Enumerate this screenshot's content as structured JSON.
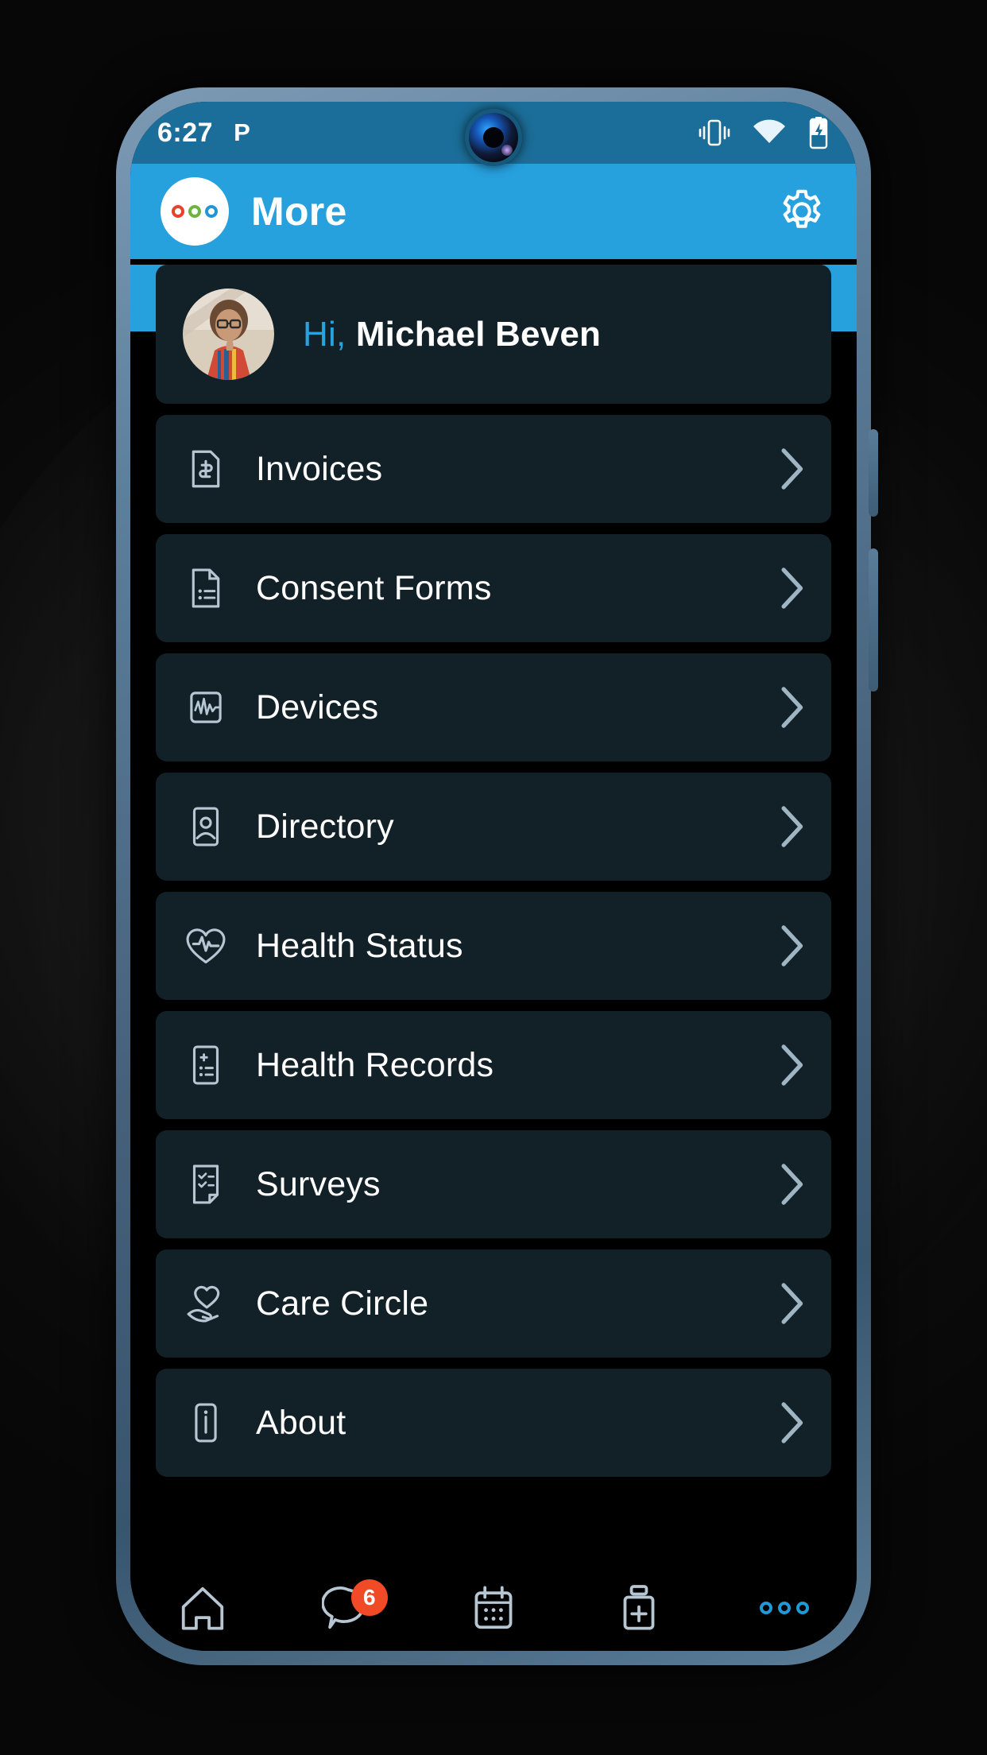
{
  "status_bar": {
    "time": "6:27",
    "carrier_glyph": "P",
    "icons": [
      "vibrate-icon",
      "wifi-icon",
      "battery-charging-icon"
    ]
  },
  "app_bar": {
    "title": "More",
    "logo_name": "app-logo",
    "logo_ring_colors": [
      "#e8412c",
      "#6cb33f",
      "#2196d6"
    ],
    "settings_icon": "gear-icon",
    "background_color": "#27a0de"
  },
  "profile": {
    "greeting_prefix": "Hi,",
    "user_name": "Michael Beven",
    "avatar_name": "user-avatar",
    "greeting_accent_color": "#29a3e0"
  },
  "menu": {
    "card_color": "#122028",
    "items": [
      {
        "label": "Invoices",
        "icon": "invoice-dollar-icon"
      },
      {
        "label": "Consent Forms",
        "icon": "document-lines-icon"
      },
      {
        "label": "Devices",
        "icon": "device-waveform-icon"
      },
      {
        "label": "Directory",
        "icon": "person-card-icon"
      },
      {
        "label": "Health Status",
        "icon": "heart-pulse-icon"
      },
      {
        "label": "Health Records",
        "icon": "medical-record-icon"
      },
      {
        "label": "Surveys",
        "icon": "checklist-icon"
      },
      {
        "label": "Care Circle",
        "icon": "heart-in-hand-icon"
      },
      {
        "label": "About",
        "icon": "info-icon"
      }
    ],
    "chevron_icon": "chevron-right-icon"
  },
  "tab_bar": {
    "tabs": [
      {
        "name": "home",
        "icon": "home-icon",
        "badge": "",
        "active": false
      },
      {
        "name": "messages",
        "icon": "chat-bubble-icon",
        "badge": "6",
        "active": false
      },
      {
        "name": "calendar",
        "icon": "calendar-icon",
        "badge": "",
        "active": false
      },
      {
        "name": "medication",
        "icon": "pill-bottle-icon",
        "badge": "",
        "active": false
      },
      {
        "name": "more",
        "icon": "three-dots-icon",
        "badge": "",
        "active": true
      }
    ],
    "badge_color": "#f04a26",
    "active_color": "#1f9ad6"
  },
  "gesture_nav": {
    "back_icon": "back-chevron-icon",
    "home_pill": "home-pill-handle"
  }
}
